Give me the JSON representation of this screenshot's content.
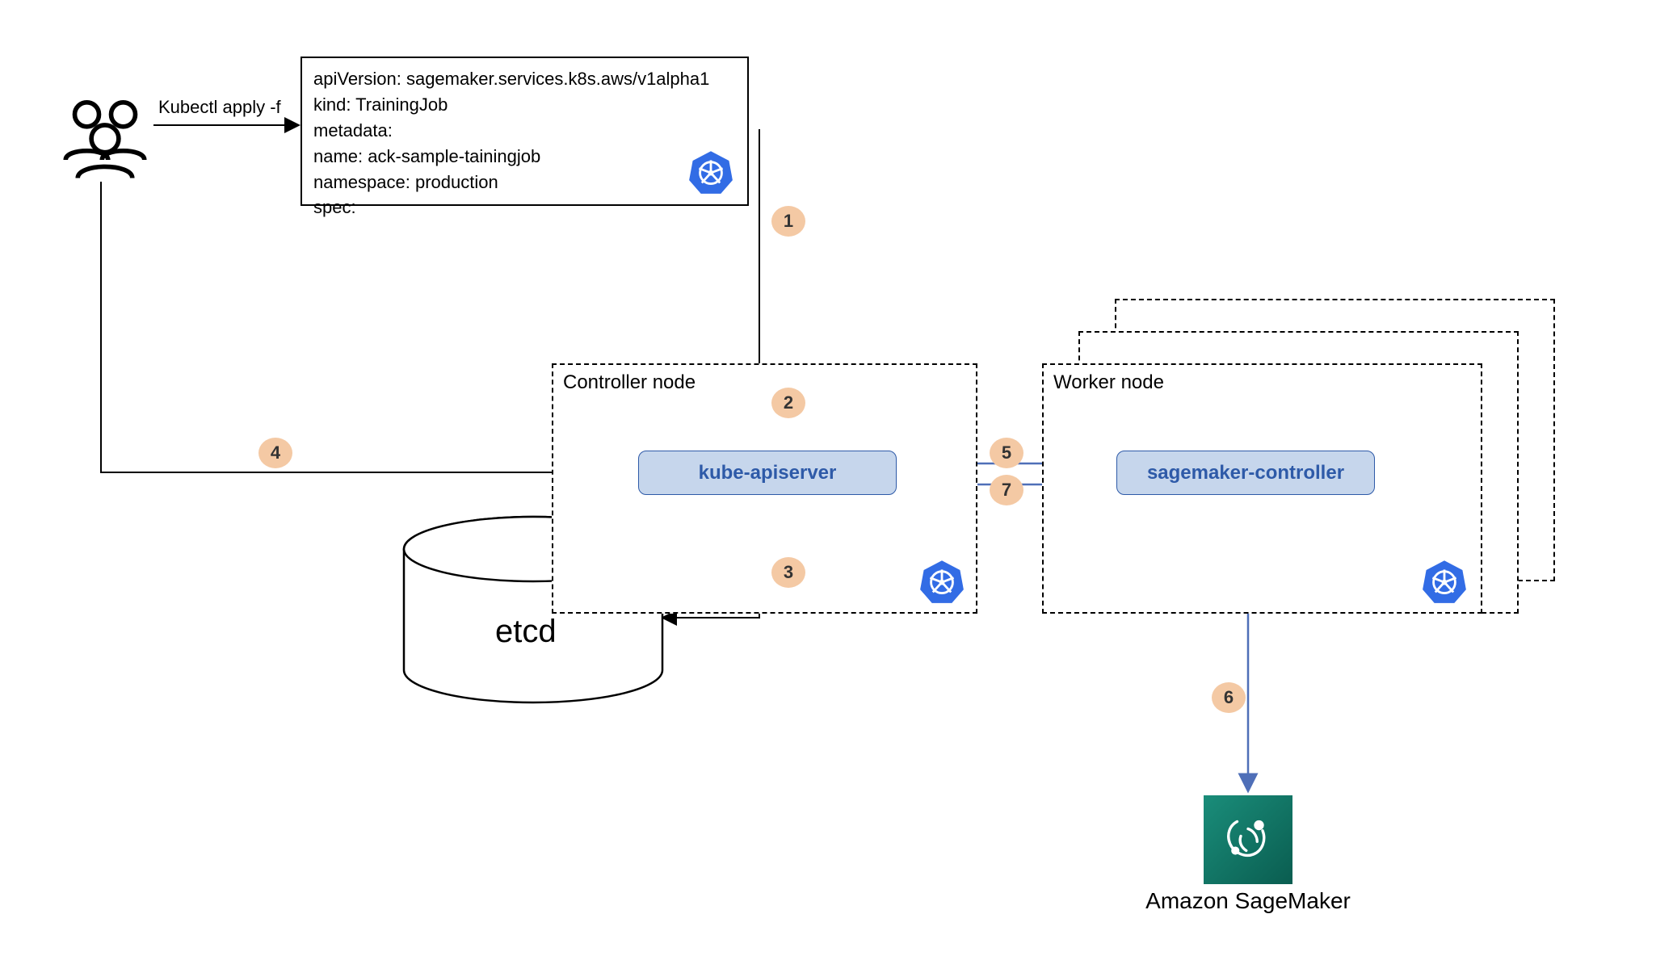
{
  "actors": {
    "users_label": ""
  },
  "commands": {
    "kubectl_apply": "Kubectl apply -f"
  },
  "yaml": {
    "l1": "apiVersion: sagemaker.services.k8s.aws/v1alpha1",
    "l2": "kind: TrainingJob",
    "l3": "metadata:",
    "l4": "name: ack-sample-tainingjob",
    "l5": "namespace: production",
    "l6": "spec:"
  },
  "containers": {
    "controller_title": "Controller node",
    "worker_title": "Worker node"
  },
  "components": {
    "kube_apiserver": "kube-apiserver",
    "sagemaker_controller": "sagemaker-controller"
  },
  "storage": {
    "etcd": "etcd"
  },
  "services": {
    "sagemaker": "Amazon SageMaker"
  },
  "steps": {
    "s1": "1",
    "s2": "2",
    "s3": "3",
    "s4": "4",
    "s5": "5",
    "s6": "6",
    "s7": "7"
  },
  "colors": {
    "k8s_blue": "#326ce5",
    "box_fill": "#c6d6ec",
    "box_stroke": "#2e5aa8",
    "badge": "#f4c9a4",
    "arrow_blue": "#4f6fb8",
    "sm_green": "#188d7a"
  }
}
